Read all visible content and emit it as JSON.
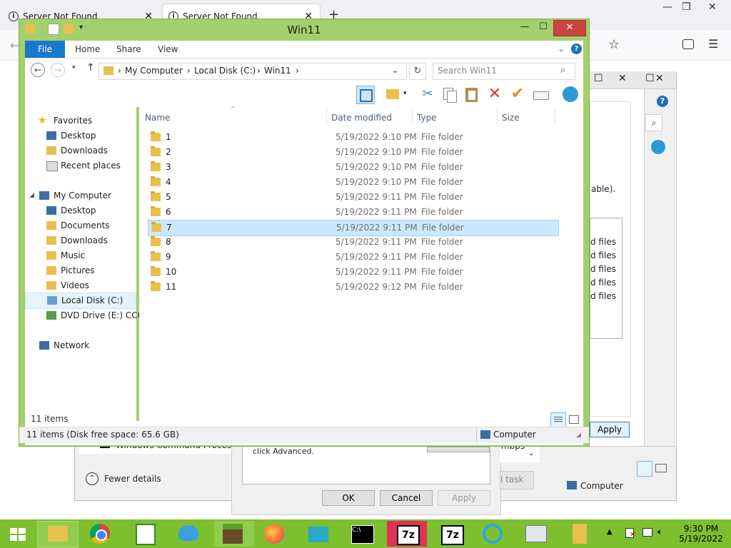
{
  "firefox": {
    "tab1_title": "Server Not Found",
    "tab2_title": "Server Not Found"
  },
  "background_dialog": {
    "partial_text_able": "able).",
    "partial_files": [
      "d files",
      "d files",
      "d files",
      "d files",
      "d files"
    ],
    "apply_label": "Apply",
    "command_processor": "Windows Command Processor",
    "fewer_details": "Fewer details",
    "mbps": "mbps",
    "click_advanced": "click Advanced.",
    "ok_label": "OK",
    "cancel_label": "Cancel",
    "apply2_label": "Apply",
    "task_label": "l task",
    "computer_label": "Computer"
  },
  "explorer": {
    "title": "Win11",
    "ribbon_tabs": [
      "File",
      "Home",
      "Share",
      "View"
    ],
    "breadcrumb": [
      "My Computer",
      "Local Disk (C:)",
      "Win11"
    ],
    "search_placeholder": "Search Win11",
    "columns": {
      "name": "Name",
      "date": "Date modified",
      "type": "Type",
      "size": "Size"
    },
    "nav": {
      "favorites": "Favorites",
      "fav_items": [
        "Desktop",
        "Downloads",
        "Recent places"
      ],
      "computer": "My Computer",
      "computer_items": [
        "Desktop",
        "Documents",
        "Downloads",
        "Music",
        "Pictures",
        "Videos",
        "Local Disk (C:)",
        "DVD Drive (E:) CCCC"
      ],
      "network": "Network"
    },
    "files": [
      {
        "name": "1",
        "date": "5/19/2022 9:10 PM",
        "type": "File folder"
      },
      {
        "name": "2",
        "date": "5/19/2022 9:10 PM",
        "type": "File folder"
      },
      {
        "name": "3",
        "date": "5/19/2022 9:10 PM",
        "type": "File folder"
      },
      {
        "name": "4",
        "date": "5/19/2022 9:10 PM",
        "type": "File folder"
      },
      {
        "name": "5",
        "date": "5/19/2022 9:11 PM",
        "type": "File folder"
      },
      {
        "name": "6",
        "date": "5/19/2022 9:11 PM",
        "type": "File folder"
      },
      {
        "name": "7",
        "date": "5/19/2022 9:11 PM",
        "type": "File folder"
      },
      {
        "name": "8",
        "date": "5/19/2022 9:11 PM",
        "type": "File folder"
      },
      {
        "name": "9",
        "date": "5/19/2022 9:11 PM",
        "type": "File folder"
      },
      {
        "name": "10",
        "date": "5/19/2022 9:11 PM",
        "type": "File folder"
      },
      {
        "name": "11",
        "date": "5/19/2022 9:12 PM",
        "type": "File folder"
      }
    ],
    "item_count": "11 items",
    "details_status": "11 items (Disk free space: 65.6 GB)",
    "details_location": "Computer"
  },
  "taskbar": {
    "time": "9:30 PM",
    "date": "5/19/2022",
    "accent": "#7dbf2f"
  }
}
